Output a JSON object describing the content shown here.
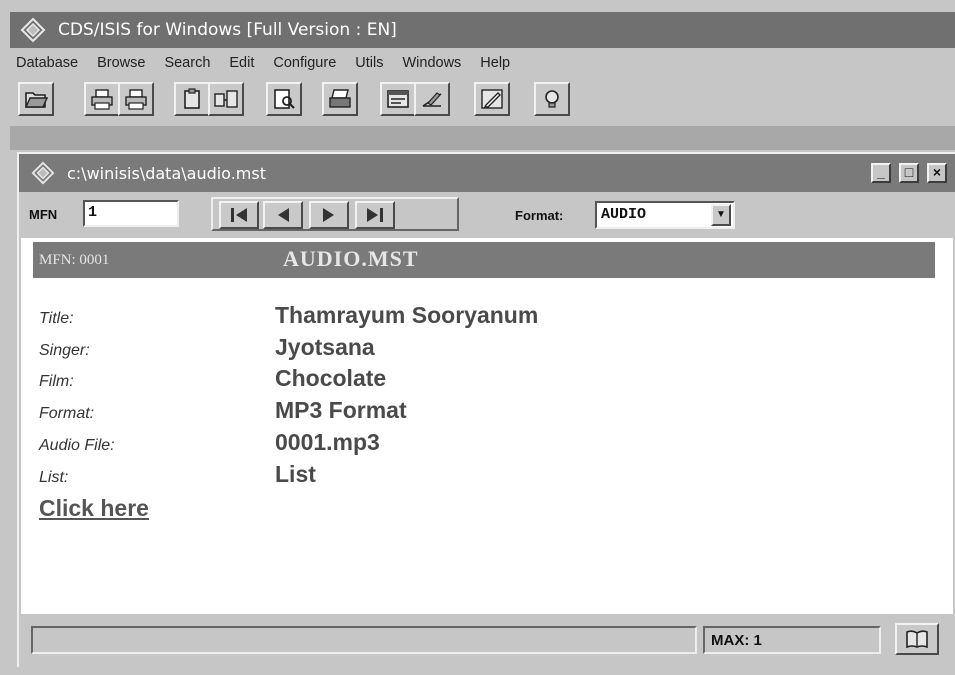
{
  "app": {
    "title": "CDS/ISIS for Windows [Full Version : EN]"
  },
  "menu": [
    "Database",
    "Browse",
    "Search",
    "Edit",
    "Configure",
    "Utils",
    "Windows",
    "Help"
  ],
  "toolbar_icons": [
    "open-folder-icon",
    "print-txt-icon",
    "print-ist-icon",
    "clipboard-icon",
    "copy-icon",
    "preview-icon",
    "printer-icon",
    "form-icon",
    "edit-icon",
    "pencil-icon",
    "lightbulb-icon"
  ],
  "child": {
    "title": "c:\\winisis\\data\\audio.mst",
    "controls": [
      "_",
      "□",
      "×"
    ]
  },
  "record_toolbar": {
    "mfn_label": "MFN",
    "mfn_value": "1",
    "nav_buttons": [
      "first-record-icon",
      "previous-record-icon",
      "next-record-icon",
      "last-record-icon"
    ],
    "format_label": "Format:",
    "format_value": "AUDIO"
  },
  "record": {
    "mfn_display": "MFN: 0001",
    "db_name": "AUDIO.MST",
    "fields": [
      {
        "label": "Title:",
        "value": "Thamrayum Sooryanum"
      },
      {
        "label": "Singer:",
        "value": "Jyotsana"
      },
      {
        "label": "Film:",
        "value": "Chocolate"
      },
      {
        "label": "Format:",
        "value": "MP3 Format"
      },
      {
        "label": "Audio File:",
        "value": "0001.mp3"
      },
      {
        "label": "List:",
        "value": "List"
      }
    ],
    "link_text": "Click here"
  },
  "statusbar": {
    "status_text": "",
    "max_text": "MAX: 1"
  },
  "colors": {
    "titlebar": "#707070",
    "header_bar": "#7a7a7a",
    "window_bg": "#c6c6c6"
  }
}
